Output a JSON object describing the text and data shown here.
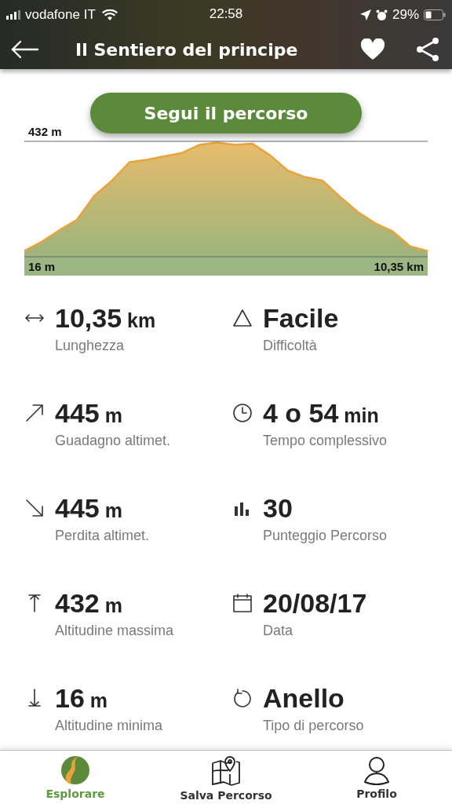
{
  "status_bar": {
    "carrier": "vodafone IT",
    "time": "22:58",
    "battery": "29%"
  },
  "header": {
    "title": "Il Sentiero del principe"
  },
  "follow_button": "Segui il percorso",
  "elevation": {
    "max_label": "432 m",
    "min_label": "16 m",
    "distance_label": "10,35 km"
  },
  "stats": [
    {
      "kind": "length",
      "value": "10,35",
      "unit": "km",
      "label": "Lunghezza"
    },
    {
      "kind": "difficulty",
      "value": "Facile",
      "label": "Difficoltà"
    },
    {
      "kind": "gain",
      "value": "445",
      "unit": "m",
      "label": "Guadagno altimet."
    },
    {
      "kind": "time",
      "value": "4 o 54",
      "unit": "min",
      "label": "Tempo complessivo"
    },
    {
      "kind": "loss",
      "value": "445",
      "unit": "m",
      "label": "Perdita altimet."
    },
    {
      "kind": "score",
      "value": "30",
      "label": "Punteggio Percorso"
    },
    {
      "kind": "max",
      "value": "432",
      "unit": "m",
      "label": "Altitudine massima"
    },
    {
      "kind": "date",
      "value": "20/08/17",
      "label": "Data"
    },
    {
      "kind": "min",
      "value": "16",
      "unit": "m",
      "label": "Altitudine minima"
    },
    {
      "kind": "loop",
      "value": "Anello",
      "label": "Tipo di percorso"
    }
  ],
  "tab_bar": [
    {
      "kind": "explore",
      "label": "Esplorare",
      "selected": true
    },
    {
      "kind": "map",
      "label": "Salva Percorso",
      "selected": false
    },
    {
      "kind": "profile",
      "label": "Profilo",
      "selected": false
    }
  ]
}
